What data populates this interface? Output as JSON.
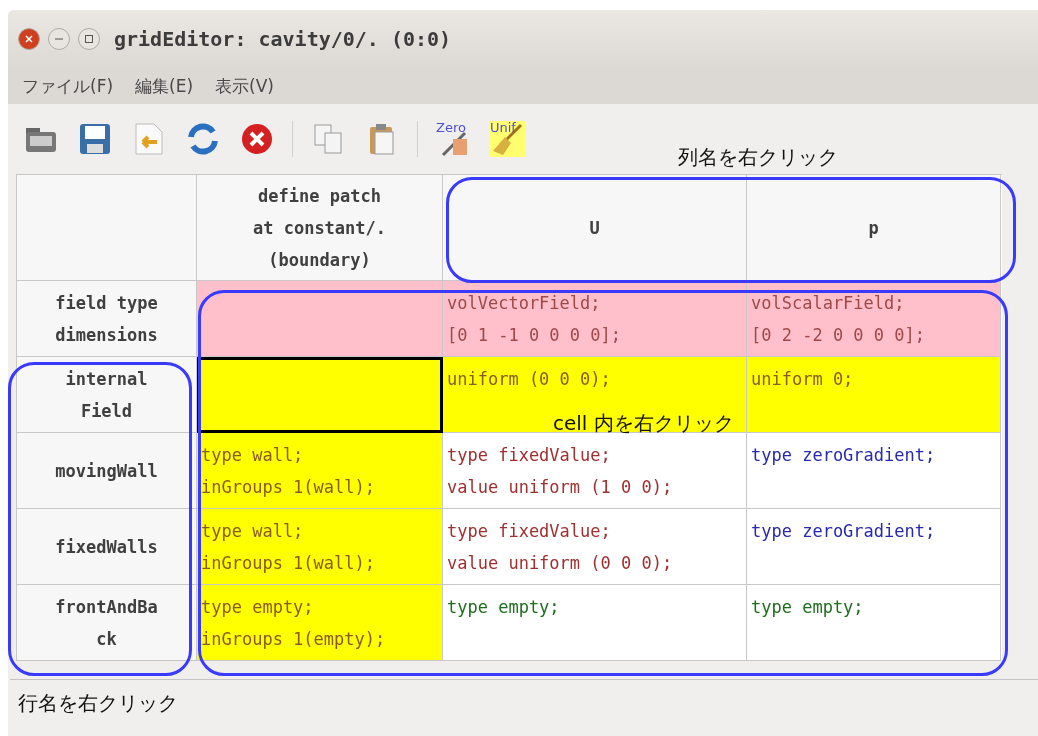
{
  "window": {
    "title": "gridEditor: cavity/0/. (0:0)"
  },
  "menu": [
    {
      "label": "ファイル(F)"
    },
    {
      "label": "編集(E)"
    },
    {
      "label": "表示(V)"
    }
  ],
  "toolbar": [
    {
      "kind": "open"
    },
    {
      "kind": "save"
    },
    {
      "kind": "import"
    },
    {
      "kind": "reload"
    },
    {
      "kind": "delete"
    },
    {
      "kind": "sep"
    },
    {
      "kind": "copy"
    },
    {
      "kind": "paste"
    },
    {
      "kind": "sep"
    },
    {
      "kind": "zero",
      "label": "Zero"
    },
    {
      "kind": "unif",
      "label": "Unif"
    }
  ],
  "table": {
    "columns": [
      "define patch\nat constant/.\n(boundary)",
      "U",
      "p"
    ],
    "rows": [
      {
        "header": "field type\ndimensions",
        "cells": [
          {
            "kind": "pink",
            "selected": false
          },
          {
            "text": "volVectorField;\n[0 1 -1 0 0 0 0];",
            "kind": "pink",
            "color": "#a04848",
            "selected": false
          },
          {
            "text": "volScalarField;\n[0 2 -2 0 0 0 0];",
            "kind": "pink",
            "color": "#a04848",
            "selected": false
          }
        ]
      },
      {
        "header": "internal\nField",
        "cells": [
          {
            "kind": "yellow",
            "selected": true
          },
          {
            "text": "uniform (0 0 0);",
            "kind": "yellow",
            "color": "#8a5a20",
            "selected": false
          },
          {
            "text": "uniform 0;",
            "kind": "yellow",
            "color": "#8a5a20",
            "selected": false
          }
        ]
      },
      {
        "header": "movingWall",
        "cells": [
          {
            "text": "type wall;\ninGroups 1(wall);",
            "kind": "yellow",
            "color": "#8a5a20",
            "selected": false
          },
          {
            "text": "type fixedValue;\nvalue uniform (1 0 0);",
            "kind": "plain",
            "color": "#a03030",
            "selected": false
          },
          {
            "text": "type zeroGradient;",
            "kind": "plain",
            "color": "#2828b0",
            "selected": false
          }
        ]
      },
      {
        "header": "fixedWalls",
        "cells": [
          {
            "text": "type wall;\ninGroups 1(wall);",
            "kind": "yellow",
            "color": "#8a5a20",
            "selected": false
          },
          {
            "text": "type fixedValue;\nvalue uniform (0 0 0);",
            "kind": "plain",
            "color": "#a03030",
            "selected": false
          },
          {
            "text": "type zeroGradient;",
            "kind": "plain",
            "color": "#2828b0",
            "selected": false
          }
        ]
      },
      {
        "header": "frontAndBa\nck",
        "cells": [
          {
            "text": "type empty;\ninGroups 1(empty);",
            "kind": "yellow",
            "color": "#8a5a20",
            "selected": false
          },
          {
            "text": "type empty;",
            "kind": "plain",
            "color": "#1e6e1e",
            "selected": false
          },
          {
            "text": "type empty;",
            "kind": "plain",
            "color": "#1e6e1e",
            "selected": false
          }
        ]
      }
    ]
  },
  "annotations": {
    "columns": "列名を右クリック",
    "cells": "cell 内を右クリック",
    "rows": "行名を右クリック"
  }
}
